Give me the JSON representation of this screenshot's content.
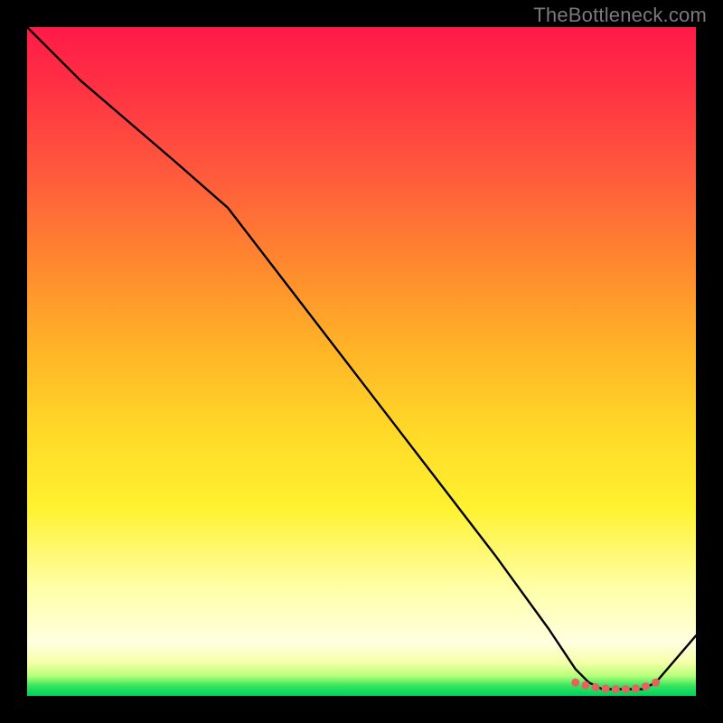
{
  "watermark": "TheBottleneck.com",
  "chart_data": {
    "type": "line",
    "title": "",
    "xlabel": "",
    "ylabel": "",
    "xlim": [
      0,
      100
    ],
    "ylim": [
      0,
      100
    ],
    "grid": false,
    "legend": false,
    "series": [
      {
        "name": "bottleneck-curve",
        "x": [
          0,
          8,
          22,
          30,
          40,
          50,
          60,
          70,
          78,
          82,
          84,
          86,
          88,
          90,
          92,
          94,
          100
        ],
        "y": [
          100,
          92,
          80,
          73,
          60,
          47,
          34,
          21,
          10,
          4,
          2,
          1,
          1,
          1,
          1,
          2,
          9
        ]
      }
    ],
    "markers": {
      "name": "optimal-range",
      "x": [
        82,
        83.5,
        85,
        86.5,
        88,
        89.5,
        91,
        92.5,
        94
      ],
      "y": [
        2,
        1.6,
        1.3,
        1.1,
        1.0,
        1.0,
        1.1,
        1.4,
        2
      ]
    },
    "gradient_stops": [
      {
        "pos": 0.0,
        "color": "#ff1a48"
      },
      {
        "pos": 0.36,
        "color": "#ff8a2e"
      },
      {
        "pos": 0.72,
        "color": "#fff230"
      },
      {
        "pos": 0.95,
        "color": "#f6ffa8"
      },
      {
        "pos": 1.0,
        "color": "#00d060"
      }
    ]
  }
}
